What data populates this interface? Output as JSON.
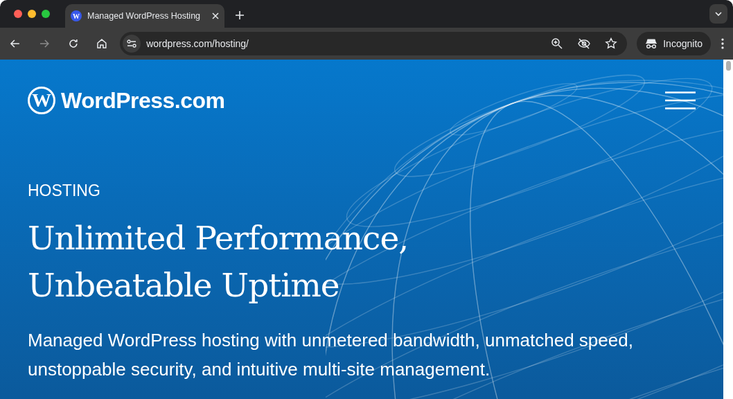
{
  "browser": {
    "tab": {
      "favicon_letter": "W",
      "title": "Managed WordPress Hosting",
      "selected": true
    },
    "address": "wordpress.com/hosting/",
    "profile": "Incognito"
  },
  "page": {
    "logo": {
      "mark": "W",
      "name": "WordPress.com"
    },
    "eyebrow": "HOSTING",
    "headline": [
      "Unlimited Performance,",
      "Unbeatable Uptime"
    ],
    "description": "Managed WordPress hosting with unmetered bandwidth, unmatched speed, unstoppable security, and intuitive multi-site management."
  }
}
